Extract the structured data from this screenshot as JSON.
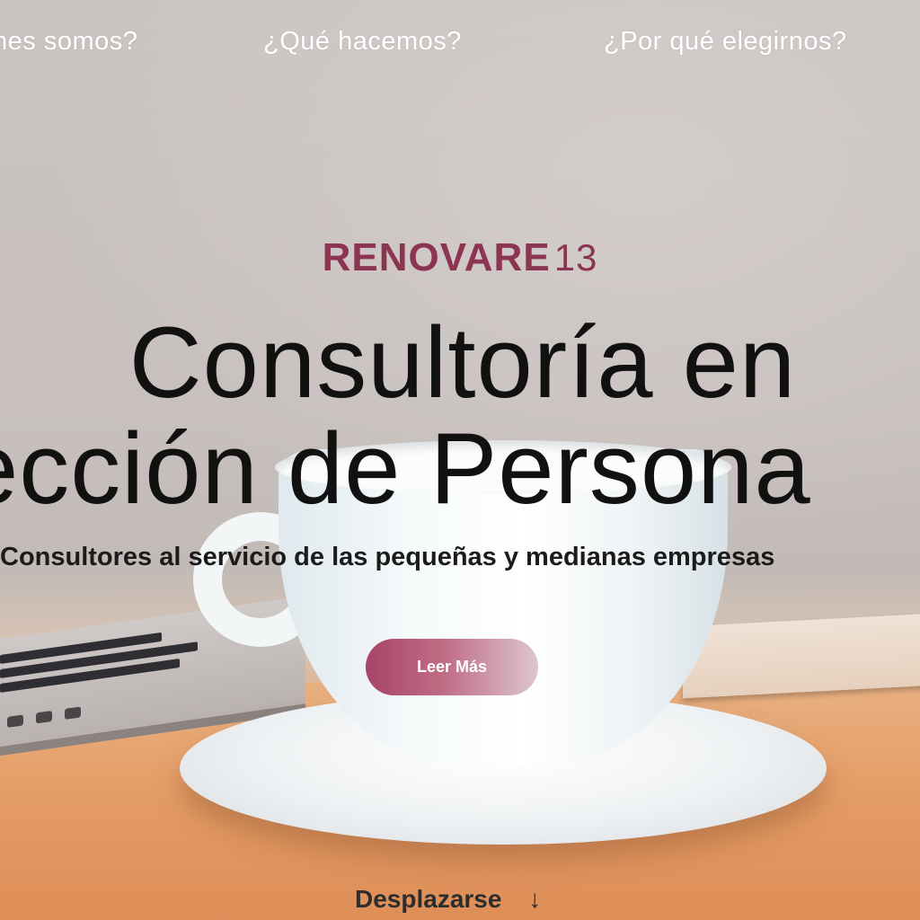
{
  "nav": {
    "items": [
      {
        "label": "nes somos?"
      },
      {
        "label": "¿Qué hacemos?"
      },
      {
        "label": "¿Por qué elegirnos?"
      }
    ]
  },
  "logo": {
    "word": "RENOVARE",
    "number": "13",
    "color": "#8c3553"
  },
  "hero": {
    "headline_line1": "Consultoría en",
    "headline_line2": "ección de Persona",
    "subtitle": "Consultores al servicio de las pequeñas y medianas empresas",
    "cta_label": "Leer Más",
    "scroll_label": "Desplazarse",
    "scroll_icon": "arrow-down-icon",
    "scroll_arrow": "↓"
  },
  "colors": {
    "accent": "#a84468",
    "text_dark": "#111111",
    "nav_text": "#ffffff"
  }
}
